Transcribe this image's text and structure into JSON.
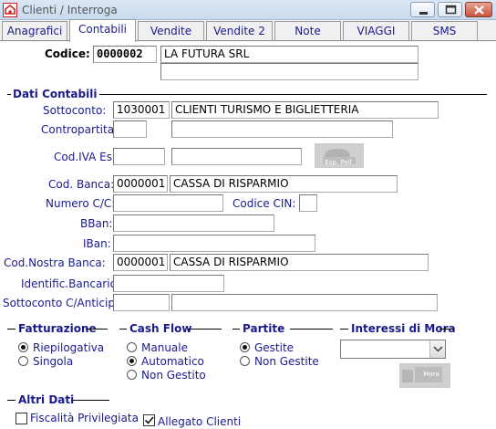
{
  "window": {
    "title": "Clienti / Interroga"
  },
  "tabs": [
    {
      "label": "Anagrafici"
    },
    {
      "label": "Contabili",
      "active": true
    },
    {
      "label": "Vendite"
    },
    {
      "label": "Vendite 2"
    },
    {
      "label": "Note"
    },
    {
      "label": "VIAGGI"
    },
    {
      "label": "SMS"
    }
  ],
  "header": {
    "codice_label": "Codice:",
    "codice_value": "0000002",
    "ragione_sociale": "LA FUTURA SRL",
    "ragione_sociale_2": ""
  },
  "dati_contabili": {
    "section_title": "Dati Contabili",
    "sottoconto_label": "Sottoconto:",
    "sottoconto_code": "1030001",
    "sottoconto_desc": "CLIENTI  TURISMO E BIGLIETTERIA",
    "contropartita_label": "Contropartita:",
    "contropartita_code": "",
    "contropartita_desc": "",
    "codiva_label": "Cod.IVA Es:",
    "codiva_code": "",
    "codiva_desc": "",
    "eso_button_label": "Esp. Poll.",
    "codbanca_label": "Cod. Banca:",
    "codbanca_code": "0000001",
    "codbanca_desc": "CASSA DI RISPARMIO",
    "numerocc_label": "Numero C/C:",
    "numerocc_value": "",
    "cin_label": "Codice CIN:",
    "cin_value": "",
    "bban_label": "BBan:",
    "bban_value": "",
    "iban_label": "IBan:",
    "iban_value": "",
    "nostrabanca_label": "Cod.Nostra Banca:",
    "nostrabanca_code": "0000001",
    "nostrabanca_desc": "CASSA DI RISPARMIO",
    "identific_label": "Identific.Bancario:",
    "identific_value": "",
    "anticipo_label": "Sottoconto C/Anticipo:",
    "anticipo_code": "",
    "anticipo_desc": ""
  },
  "fatturazione": {
    "title": "Fatturazione",
    "options": [
      {
        "label": "Riepilogativa",
        "selected": true
      },
      {
        "label": "Singola",
        "selected": false
      }
    ]
  },
  "cash_flow": {
    "title": "Cash Flow",
    "options": [
      {
        "label": "Manuale",
        "selected": false
      },
      {
        "label": "Automatico",
        "selected": true
      },
      {
        "label": "Non Gestito",
        "selected": false
      }
    ]
  },
  "partite": {
    "title": "Partite",
    "options": [
      {
        "label": "Gestite",
        "selected": true
      },
      {
        "label": "Non Gestite",
        "selected": false
      }
    ]
  },
  "interessi_mora": {
    "title": "Interessi di Mora",
    "selected_value": "",
    "button_label": "Mora"
  },
  "altri_dati": {
    "title": "Altri Dati",
    "fiscalita_label": "Fiscalità Privilegiata",
    "fiscalita_checked": false,
    "allegato_label": "Allegato Clienti",
    "allegato_checked": true
  }
}
